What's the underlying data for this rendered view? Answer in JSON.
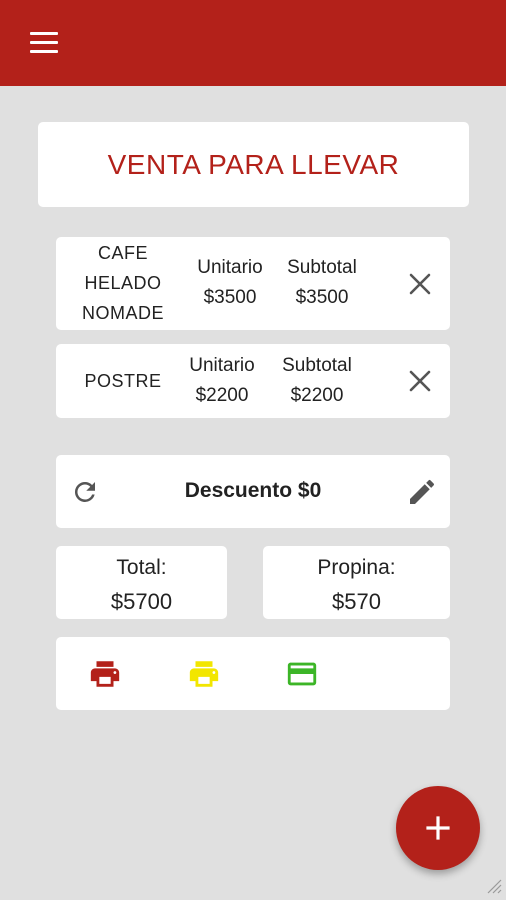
{
  "header": {
    "menu_icon": "hamburger-menu-icon",
    "accent_color": "#b3211a"
  },
  "order": {
    "title": "VENTA PARA LLEVAR"
  },
  "items": [
    {
      "name_lines": [
        "CAFE",
        "HELADO",
        "NOMADE"
      ],
      "unit_label": "Unitario",
      "unit_price": "$3500",
      "subtotal_label": "Subtotal",
      "subtotal": "$3500"
    },
    {
      "name_lines": [
        "POSTRE"
      ],
      "unit_label": "Unitario",
      "unit_price": "$2200",
      "subtotal_label": "Subtotal",
      "subtotal": "$2200"
    }
  ],
  "discount": {
    "text": "Descuento $0"
  },
  "totals": {
    "total_label": "Total:",
    "total_value": "$5700",
    "tip_label": "Propina:",
    "tip_value": "$570"
  },
  "actions": [
    {
      "icon": "print-icon",
      "color": "#b3211a"
    },
    {
      "icon": "print-icon",
      "color": "#f2e600"
    },
    {
      "icon": "credit-card-icon",
      "color": "#3cb527"
    }
  ],
  "fab": {
    "icon": "add-icon"
  }
}
